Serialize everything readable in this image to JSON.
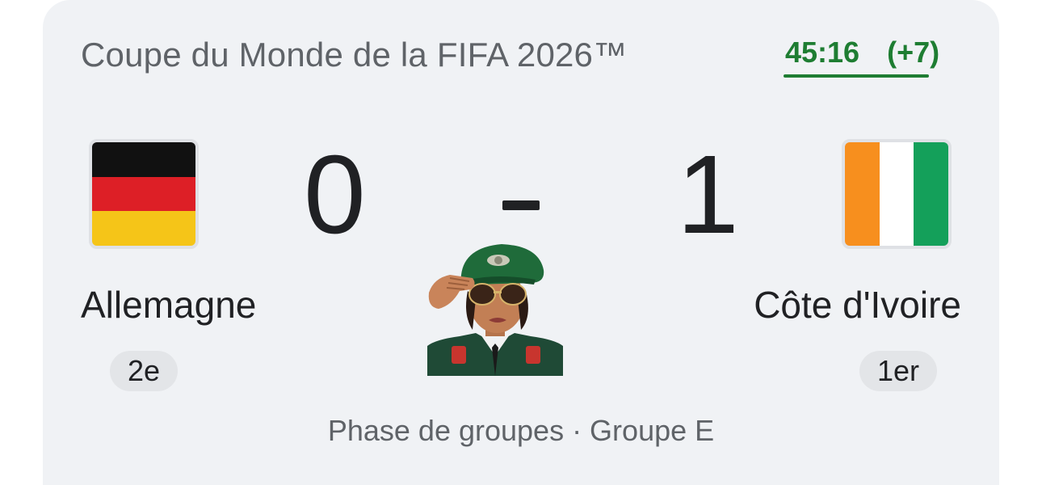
{
  "competition": "Coupe du Monde de la FIFA 2026™",
  "live": {
    "clock": "45:16",
    "added_time": "(+7)",
    "color": "#1e7d32"
  },
  "home": {
    "name": "Allemagne",
    "score": "0",
    "rank": "2e",
    "flag_icon": "germany-flag-icon",
    "flag_colors": [
      "#111111",
      "#dd1f26",
      "#f5c518"
    ]
  },
  "away": {
    "name": "Côte d'Ivoire",
    "score": "1",
    "rank": "1er",
    "flag_icon": "ivory-coast-flag-icon",
    "flag_colors": [
      "#f78f1e",
      "#ffffff",
      "#14a05a"
    ]
  },
  "separator": "-",
  "phase": "Phase de groupes · Groupe E",
  "sticker": {
    "icon": "saluting-officer-sticker"
  }
}
